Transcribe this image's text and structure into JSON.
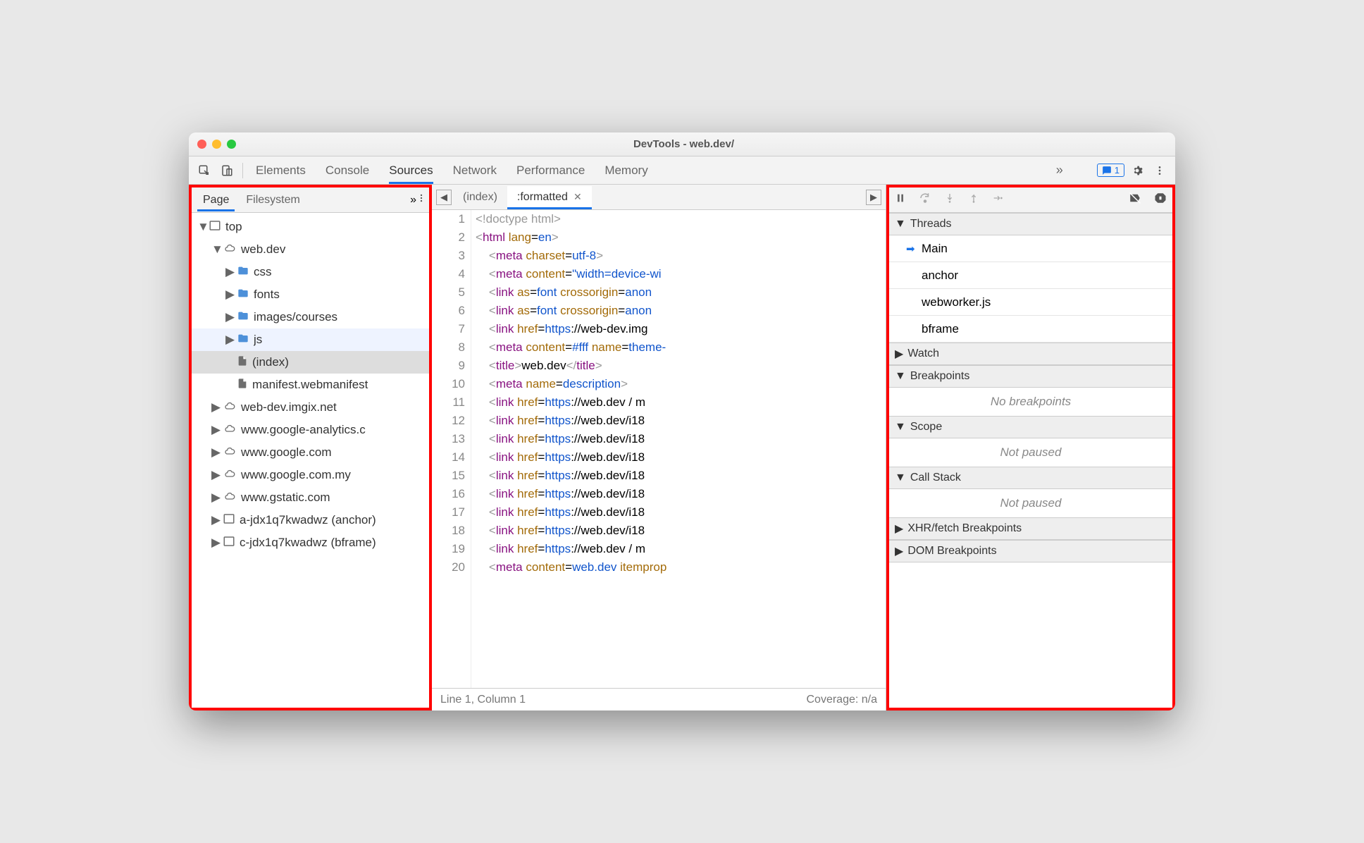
{
  "window_title": "DevTools - web.dev/",
  "tabs": [
    "Elements",
    "Console",
    "Sources",
    "Network",
    "Performance",
    "Memory"
  ],
  "active_tab": "Sources",
  "issues_badge": "1",
  "nav": {
    "sub_tabs": [
      "Page",
      "Filesystem"
    ],
    "active_sub_tab": "Page",
    "tree": [
      {
        "depth": 0,
        "icon": "frame",
        "label": "top",
        "arrow": "down"
      },
      {
        "depth": 1,
        "icon": "cloud",
        "label": "web.dev",
        "arrow": "down"
      },
      {
        "depth": 2,
        "icon": "folder",
        "label": "css",
        "arrow": "right"
      },
      {
        "depth": 2,
        "icon": "folder",
        "label": "fonts",
        "arrow": "right"
      },
      {
        "depth": 2,
        "icon": "folder",
        "label": "images/courses",
        "arrow": "right"
      },
      {
        "depth": 2,
        "icon": "folder",
        "label": "js",
        "arrow": "right",
        "hov": true
      },
      {
        "depth": 2,
        "icon": "file",
        "label": "(index)",
        "sel": true
      },
      {
        "depth": 2,
        "icon": "file",
        "label": "manifest.webmanifest"
      },
      {
        "depth": 1,
        "icon": "cloud",
        "label": "web-dev.imgix.net",
        "arrow": "right"
      },
      {
        "depth": 1,
        "icon": "cloud",
        "label": "www.google-analytics.c",
        "arrow": "right"
      },
      {
        "depth": 1,
        "icon": "cloud",
        "label": "www.google.com",
        "arrow": "right"
      },
      {
        "depth": 1,
        "icon": "cloud",
        "label": "www.google.com.my",
        "arrow": "right"
      },
      {
        "depth": 1,
        "icon": "cloud",
        "label": "www.gstatic.com",
        "arrow": "right"
      },
      {
        "depth": 1,
        "icon": "frame",
        "label": "a-jdx1q7kwadwz (anchor)",
        "arrow": "right"
      },
      {
        "depth": 1,
        "icon": "frame",
        "label": "c-jdx1q7kwadwz (bframe)",
        "arrow": "right"
      }
    ]
  },
  "editor": {
    "file_tabs": [
      {
        "label": "(index)",
        "active": false
      },
      {
        "label": ":formatted",
        "active": true,
        "closable": true
      }
    ],
    "lines": [
      "<span class='tk-gray'>&lt;!doctype html&gt;</span>",
      "<span class='tk-gray'>&lt;</span><span class='tk-purple'>html</span> <span class='tk-orange'>lang</span>=<span class='tk-blue'>en</span><span class='tk-gray'>&gt;</span>",
      "    <span class='tk-gray'>&lt;</span><span class='tk-purple'>meta</span> <span class='tk-orange'>charset</span>=<span class='tk-blue'>utf-8</span><span class='tk-gray'>&gt;</span>",
      "    <span class='tk-gray'>&lt;</span><span class='tk-purple'>meta</span> <span class='tk-orange'>content</span>=<span class='tk-blue'>\"width=device-wi</span>",
      "    <span class='tk-gray'>&lt;</span><span class='tk-purple'>link</span> <span class='tk-orange'>as</span>=<span class='tk-blue'>font</span> <span class='tk-orange'>crossorigin</span>=<span class='tk-blue'>anon</span>",
      "    <span class='tk-gray'>&lt;</span><span class='tk-purple'>link</span> <span class='tk-orange'>as</span>=<span class='tk-blue'>font</span> <span class='tk-orange'>crossorigin</span>=<span class='tk-blue'>anon</span>",
      "    <span class='tk-gray'>&lt;</span><span class='tk-purple'>link</span> <span class='tk-orange'>href</span>=<span class='tk-blue'>https</span>://web-dev.img",
      "    <span class='tk-gray'>&lt;</span><span class='tk-purple'>meta</span> <span class='tk-orange'>content</span>=<span class='tk-blue'>#fff</span> <span class='tk-orange'>name</span>=<span class='tk-blue'>theme-</span>",
      "    <span class='tk-gray'>&lt;</span><span class='tk-purple'>title</span><span class='tk-gray'>&gt;</span>web.dev<span class='tk-gray'>&lt;/</span><span class='tk-purple'>title</span><span class='tk-gray'>&gt;</span>",
      "    <span class='tk-gray'>&lt;</span><span class='tk-purple'>meta</span> <span class='tk-orange'>name</span>=<span class='tk-blue'>description</span><span class='tk-gray'>&gt;</span>",
      "    <span class='tk-gray'>&lt;</span><span class='tk-purple'>link</span> <span class='tk-orange'>href</span>=<span class='tk-blue'>https</span>://web.dev / m",
      "    <span class='tk-gray'>&lt;</span><span class='tk-purple'>link</span> <span class='tk-orange'>href</span>=<span class='tk-blue'>https</span>://web.dev/i18",
      "    <span class='tk-gray'>&lt;</span><span class='tk-purple'>link</span> <span class='tk-orange'>href</span>=<span class='tk-blue'>https</span>://web.dev/i18",
      "    <span class='tk-gray'>&lt;</span><span class='tk-purple'>link</span> <span class='tk-orange'>href</span>=<span class='tk-blue'>https</span>://web.dev/i18",
      "    <span class='tk-gray'>&lt;</span><span class='tk-purple'>link</span> <span class='tk-orange'>href</span>=<span class='tk-blue'>https</span>://web.dev/i18",
      "    <span class='tk-gray'>&lt;</span><span class='tk-purple'>link</span> <span class='tk-orange'>href</span>=<span class='tk-blue'>https</span>://web.dev/i18",
      "    <span class='tk-gray'>&lt;</span><span class='tk-purple'>link</span> <span class='tk-orange'>href</span>=<span class='tk-blue'>https</span>://web.dev/i18",
      "    <span class='tk-gray'>&lt;</span><span class='tk-purple'>link</span> <span class='tk-orange'>href</span>=<span class='tk-blue'>https</span>://web.dev/i18",
      "    <span class='tk-gray'>&lt;</span><span class='tk-purple'>link</span> <span class='tk-orange'>href</span>=<span class='tk-blue'>https</span>://web.dev / m",
      "    <span class='tk-gray'>&lt;</span><span class='tk-purple'>meta</span> <span class='tk-orange'>content</span>=<span class='tk-blue'>web.dev</span> <span class='tk-orange'>itemprop</span>"
    ],
    "status_left": "Line 1, Column 1",
    "status_right": "Coverage: n/a"
  },
  "debugger": {
    "sections": [
      {
        "title": "Threads",
        "open": true,
        "rows": [
          {
            "label": "Main",
            "current": true
          },
          {
            "label": "anchor"
          },
          {
            "label": "webworker.js"
          },
          {
            "label": "bframe"
          }
        ]
      },
      {
        "title": "Watch",
        "open": false
      },
      {
        "title": "Breakpoints",
        "open": true,
        "empty": "No breakpoints"
      },
      {
        "title": "Scope",
        "open": true,
        "empty": "Not paused"
      },
      {
        "title": "Call Stack",
        "open": true,
        "empty": "Not paused"
      },
      {
        "title": "XHR/fetch Breakpoints",
        "open": false
      },
      {
        "title": "DOM Breakpoints",
        "open": false
      }
    ]
  }
}
